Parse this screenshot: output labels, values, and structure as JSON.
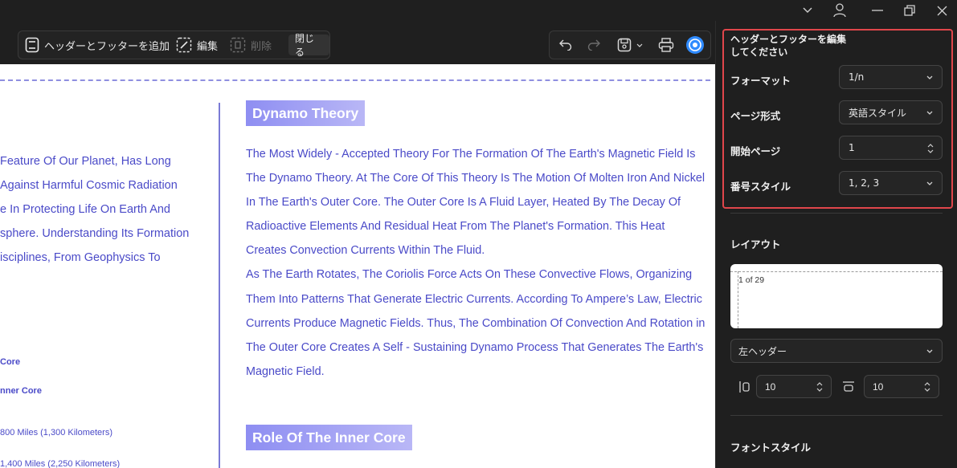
{
  "toolbar": {
    "add_header_footer": "ヘッダーとフッターを追加",
    "edit": "編集",
    "delete": "削除",
    "close": "閉じる"
  },
  "document": {
    "left_lines": [
      "Feature Of Our Planet, Has Long",
      " Against Harmful Cosmic Radiation",
      "e In Protecting Life On Earth And",
      "sphere. Understanding Its Formation",
      "isciplines, From Geophysics To"
    ],
    "left_small": {
      "core": "Core",
      "inner_core": "nner Core",
      "miles_1": " 800 Miles (1,300 Kilometers)",
      "miles_2": " 1,400 Miles (2,250 Kilometers)"
    },
    "heading_1": "Dynamo Theory",
    "para_1": "The Most Widely - Accepted Theory For The Formation Of The Earth's Magnetic Field Is The Dynamo Theory. At The Core Of This Theory Is The Motion Of Molten Iron And Nickel In The Earth's Outer Core. The Outer Core Is A Fluid Layer, Heated By The Decay Of Radioactive Elements And Residual Heat From The Planet's Formation. This Heat Creates Convection Currents Within The Fluid.",
    "para_2": "As The Earth Rotates, The Coriolis Force Acts On These Convective Flows, Organizing Them Into Patterns That Generate Electric Currents. According To Ampere’s Law, Electric Currents Produce Magnetic Fields. Thus, The Combination Of Convection And Rotation in The Outer Core Creates A Self - Sustaining Dynamo Process That Generates The Earth's Magnetic Field.",
    "heading_2": "Role Of The Inner Core"
  },
  "panel": {
    "title": "ヘッダーとフッターを編集してください",
    "format_label": "フォーマット",
    "format_value": "1/n",
    "page_format_label": "ページ形式",
    "page_format_value": "英語スタイル",
    "start_page_label": "開始ページ",
    "start_page_value": "1",
    "number_style_label": "番号スタイル",
    "number_style_value": "1, 2, 3",
    "layout_title": "レイアウト",
    "preview_text": "1 of 29",
    "position_value": "左ヘッダー",
    "margin_left_value": "10",
    "margin_top_value": "10",
    "font_style_title": "フォントスタイル"
  },
  "colors": {
    "accent_red": "#e0464b",
    "doc_text": "#4a4ac8",
    "panel_bg": "#1f1f1f"
  }
}
